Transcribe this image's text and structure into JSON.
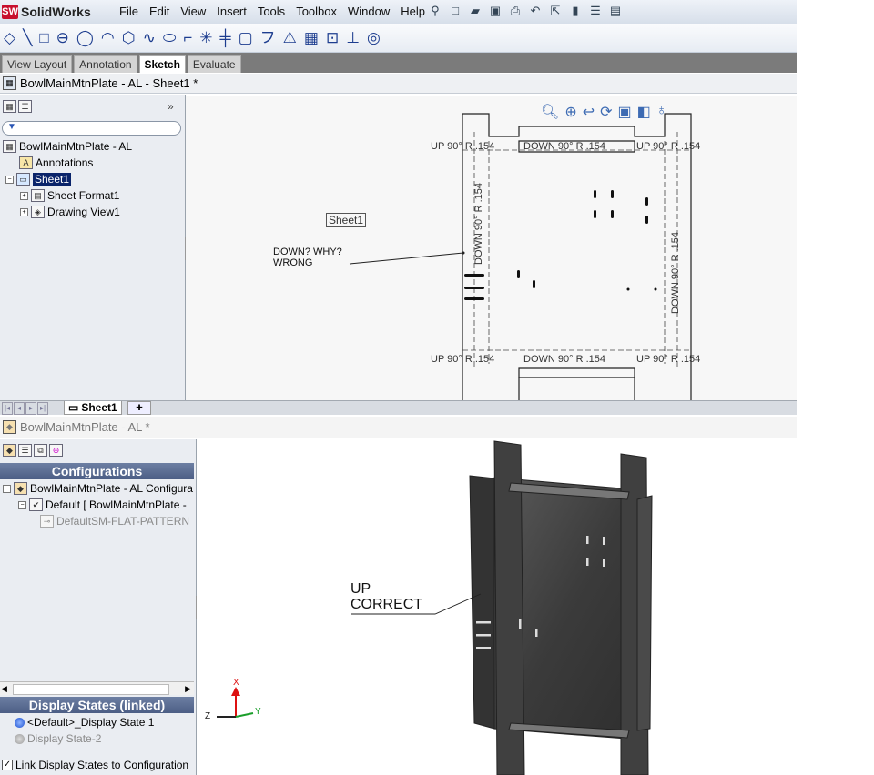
{
  "app": {
    "logo": "SolidWorks"
  },
  "menu": {
    "items": [
      "File",
      "Edit",
      "View",
      "Insert",
      "Tools",
      "Toolbox",
      "Window",
      "Help"
    ]
  },
  "command_tabs": [
    "View Layout",
    "Annotation",
    "Sketch",
    "Evaluate"
  ],
  "active_tab": "Sketch",
  "drawing_doc": {
    "title": "BowlMainMtnPlate - AL - Sheet1 *",
    "tree_root": "BowlMainMtnPlate - AL",
    "tree": {
      "annotations": "Annotations",
      "sheet": "Sheet1",
      "sheet_format": "Sheet Format1",
      "drawing_view": "Drawing View1"
    },
    "sheet_tab": "Sheet1",
    "sheet_label": "Sheet1",
    "note_line1": "DOWN? WHY?",
    "note_line2": "WRONG",
    "dims": {
      "top_left": "UP  90°  R .154",
      "top_center": "DOWN  90°  R .154",
      "top_right": "UP  90°  R .154",
      "bottom_left": "UP  90°  R .154",
      "bottom_center": "DOWN  90°  R .154",
      "bottom_right": "UP  90°  R .154",
      "left_vertical": "DOWN  90°  R .154",
      "right_vertical": "DOWN  90°  R .154"
    }
  },
  "part_doc": {
    "title": "BowlMainMtnPlate - AL *",
    "config_header": "Configurations",
    "config_root": "BowlMainMtnPlate - AL Configura",
    "config_default": "Default [ BowlMainMtnPlate -",
    "config_flat": "DefaultSM-FLAT-PATTERN",
    "display_states_header": "Display States (linked)",
    "display_state_1": "<Default>_Display State 1",
    "display_state_2": "Display State-2",
    "link_checkbox": "Link Display States to Configuration",
    "note_line1": "UP",
    "note_line2": "CORRECT",
    "triad": {
      "x": "X",
      "y": "Y",
      "z": "Z"
    }
  },
  "colors": {
    "accent": "#c8102e",
    "header": "#4c5e85",
    "selection": "#0a246a"
  }
}
